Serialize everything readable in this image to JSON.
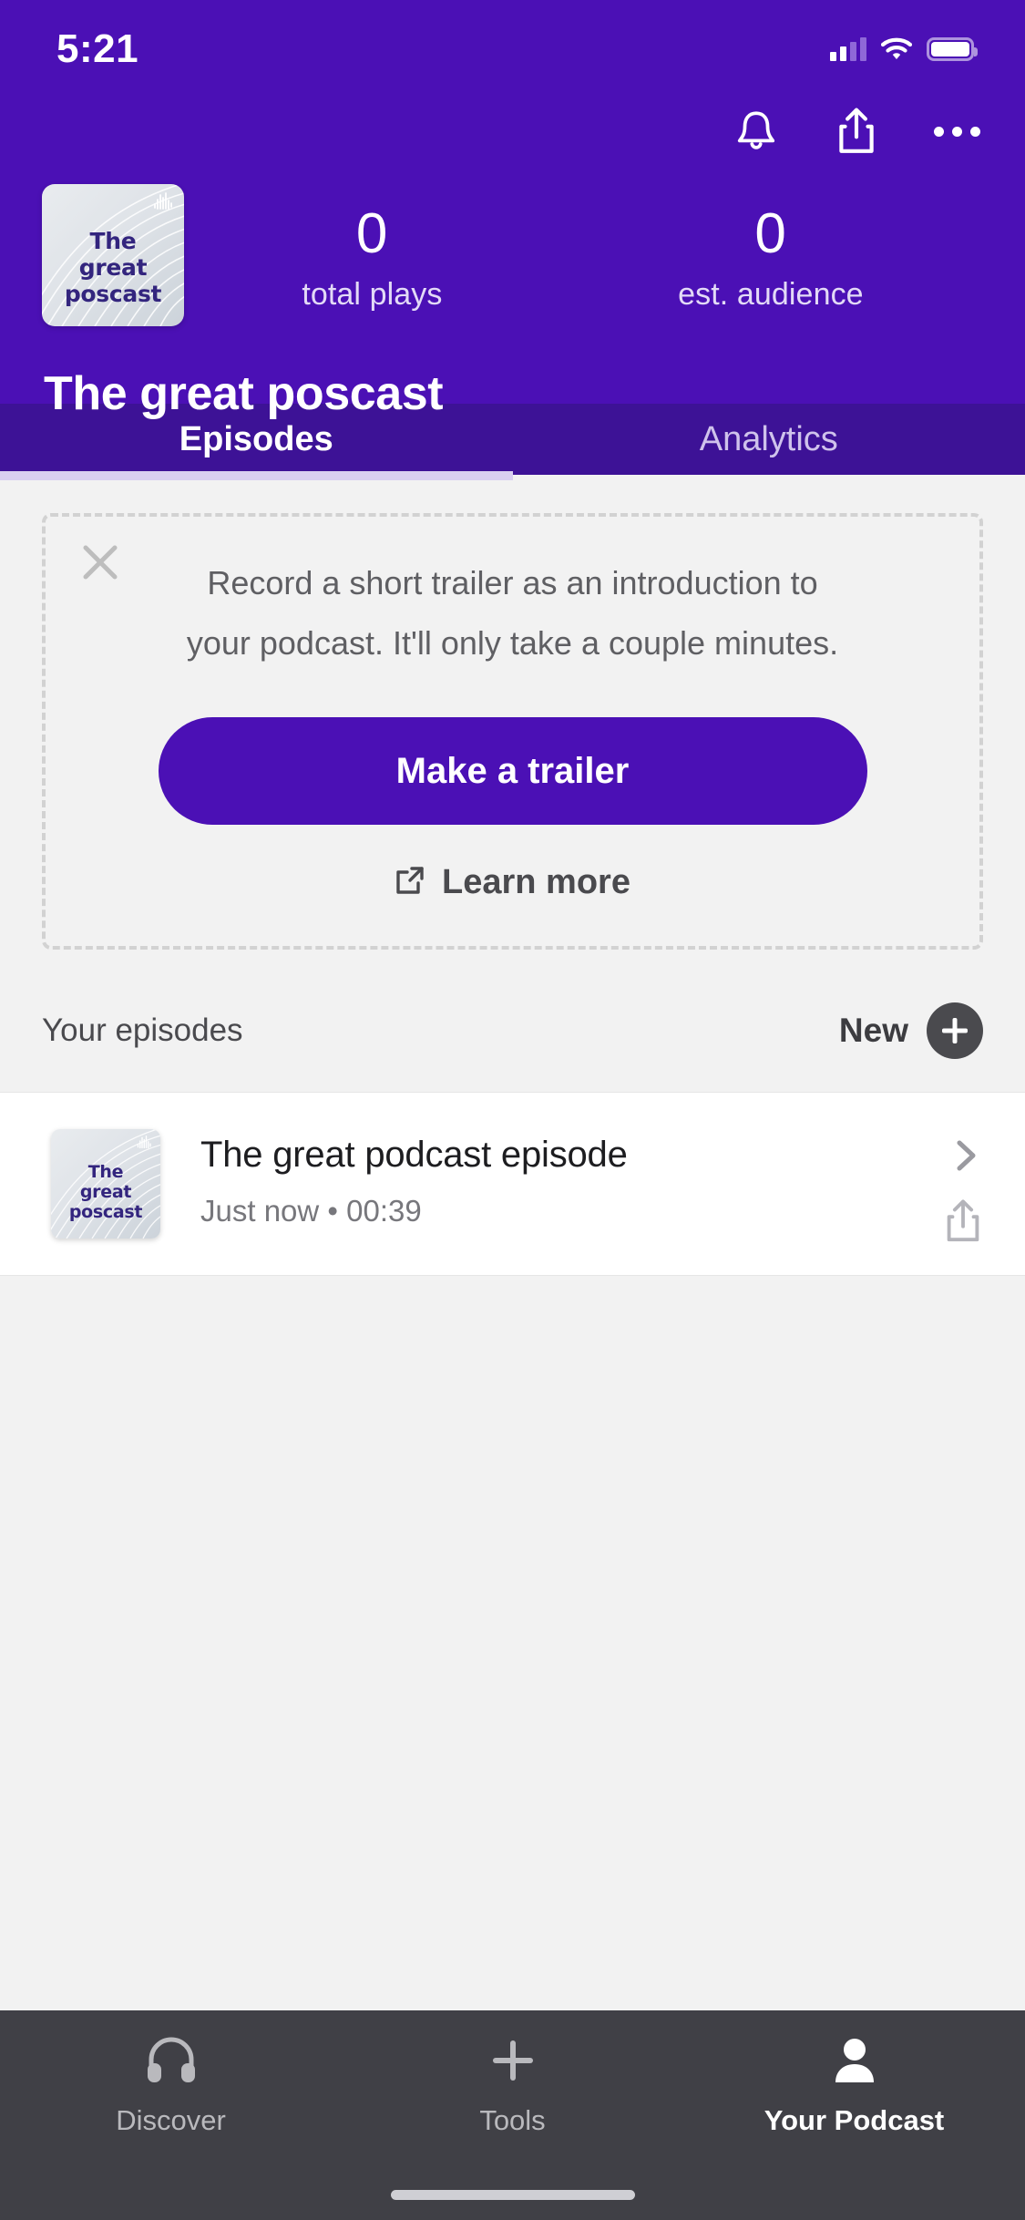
{
  "status_bar": {
    "time": "5:21",
    "signal_icon": "cellular-signal-icon",
    "wifi_icon": "wifi-icon",
    "battery_icon": "battery-icon"
  },
  "header": {
    "background_color": "#4b10b5",
    "actions": [
      {
        "name": "notifications-button",
        "icon": "bell-icon"
      },
      {
        "name": "share-button",
        "icon": "share-icon"
      },
      {
        "name": "more-options-button",
        "icon": "overflow-menu-icon"
      }
    ],
    "cover_art": {
      "icon": "podcast-cover-art",
      "text_lines": [
        "The",
        "great",
        "poscast"
      ],
      "badge_icon": "waveform-icon",
      "text_color": "#33257e"
    },
    "stats": [
      {
        "value": "0",
        "label": "total plays"
      },
      {
        "value": "0",
        "label": "est. audience"
      }
    ],
    "title": "The great poscast"
  },
  "tabs": [
    {
      "label": "Episodes",
      "active": true
    },
    {
      "label": "Analytics",
      "active": false
    }
  ],
  "trailer_card": {
    "close_icon": "close-icon",
    "description_line1": "Record a short trailer as an introduction to",
    "description_line2": "your podcast. It'll only take a couple minutes.",
    "primary_button": "Make a trailer",
    "learn_more_label": "Learn more",
    "learn_more_icon": "external-link-icon",
    "button_color": "#4b10b5"
  },
  "episodes_section": {
    "heading": "Your episodes",
    "new_label": "New",
    "new_icon": "plus-icon",
    "items": [
      {
        "cover_text_lines": [
          "The",
          "great",
          "poscast"
        ],
        "cover_badge_icon": "waveform-icon",
        "title": "The great podcast episode",
        "meta": "Just now • 00:39",
        "chevron_icon": "chevron-right-icon",
        "share_icon": "share-icon"
      }
    ]
  },
  "bottom_nav": [
    {
      "label": "Discover",
      "icon": "headphones-icon",
      "active": false
    },
    {
      "label": "Tools",
      "icon": "plus-icon",
      "active": false
    },
    {
      "label": "Your Podcast",
      "icon": "person-icon",
      "active": true
    }
  ]
}
